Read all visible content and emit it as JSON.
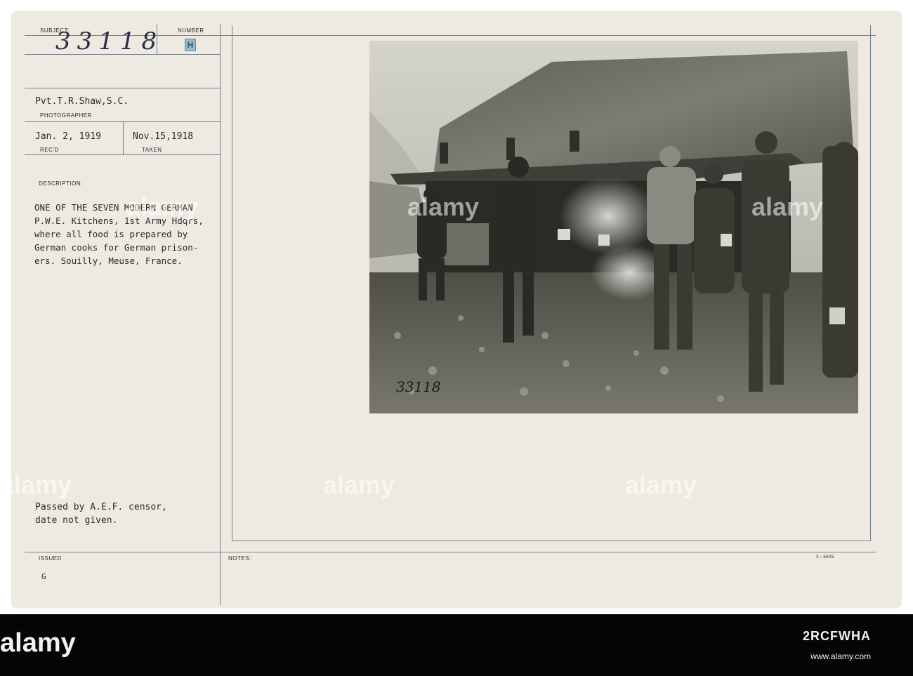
{
  "card": {
    "subject_label": "SUBJECT:",
    "subject_number": "33118",
    "number_label": "NUMBER",
    "number_stamp": "H",
    "photographer_name": "Pvt.T.R.Shaw,S.C.",
    "photographer_label": "PHOTOGRAPHER",
    "received_date": "Jan. 2, 1919",
    "received_label": "REC'D",
    "taken_date": "Nov.15,1918",
    "taken_label": "TAKEN",
    "description_label": "DESCRIPTION:",
    "description_lines": [
      "ONE OF THE SEVEN MODERN GERMAN",
      "P.W.E. Kitchens, 1st Army Hdqrs,",
      "where all food is prepared by",
      "German cooks for German prison-",
      "ers. Souilly, Meuse, France."
    ],
    "censor_lines": [
      "Passed by A.E.F. censor,",
      "date not given."
    ],
    "issued_label": "ISSUED",
    "issued_value": "G",
    "notes_label": "NOTES:",
    "form_code": "3—5605"
  },
  "photo": {
    "negative_number": "33118"
  },
  "watermark": {
    "text": "alamy"
  },
  "strip": {
    "brand": "alamy",
    "image_id": "2RCFWHA",
    "url": "www.alamy.com"
  }
}
